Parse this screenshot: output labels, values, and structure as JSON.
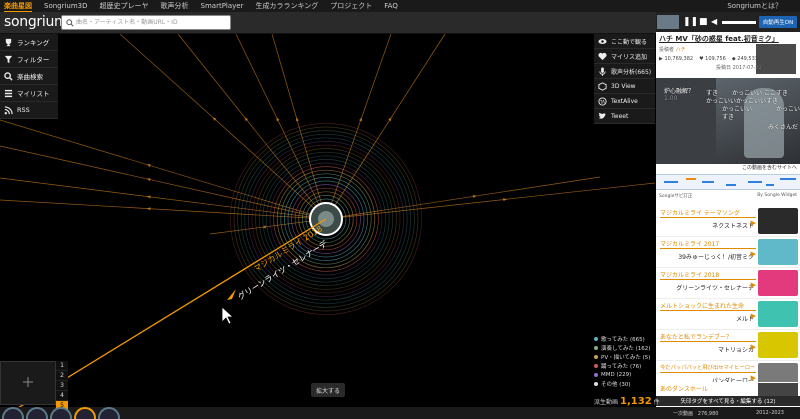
{
  "topnav": {
    "items": [
      "楽曲星図",
      "Songrium3D",
      "超歴史プレーヤ",
      "歌声分析",
      "SmartPlayer",
      "生成カラランキング",
      "プロジェクト",
      "FAQ"
    ],
    "right": "Songriumとは？"
  },
  "header": {
    "logo": "songrium",
    "search_placeholder": "曲名・アーティスト名・動画URL・ID"
  },
  "leftmenu": [
    {
      "label": "ランキング",
      "icon": "trophy-icon"
    },
    {
      "label": "フィルター",
      "icon": "filter-icon"
    },
    {
      "label": "楽曲検索",
      "icon": "search-icon"
    },
    {
      "label": "マイリスト",
      "icon": "list-icon"
    },
    {
      "label": "RSS",
      "icon": "rss-icon"
    }
  ],
  "rightmenu": [
    {
      "label": "ここ動で観る",
      "icon": "eye-icon"
    },
    {
      "label": "マイリス追加",
      "icon": "heart-icon"
    },
    {
      "label": "歌声分析(665)",
      "icon": "mic-icon"
    },
    {
      "label": "3D View",
      "icon": "3d-icon"
    },
    {
      "label": "TextAlive",
      "icon": "textalive-icon"
    },
    {
      "label": "Tweet",
      "icon": "twitter-icon"
    }
  ],
  "song": {
    "title": "ハチ MV「砂の惑星 feat.初音ミク」",
    "poster_label": "投稿者",
    "poster": "ハチ",
    "views": "10,769,382",
    "mylists": "109,756",
    "likes": "249,533",
    "date_label": "投稿日",
    "date": "2017-07-21"
  },
  "player": {
    "autoplay": "自動再生ON"
  },
  "video_comments": [
    "炉心融解？",
    "1.00",
    "すき",
    "かっこいい",
    "ここすき",
    "かっこいい",
    "かっこいい",
    "すき",
    "かっこいい",
    "かっこいい",
    "すき",
    "みくさんだ"
  ],
  "related_head": "この動画を含むサイトへ",
  "sabi": {
    "left": "Songleサビ訂正",
    "right": "By Songle Widget"
  },
  "related": [
    {
      "category": "マジカルミライ テーマソング",
      "song": "ネクストネスト",
      "thumb": "#2a2a2a"
    },
    {
      "category": "マジカルミライ 2017",
      "song": "39みゅーじっく！/初音ミク",
      "thumb": "#5fb9c8"
    },
    {
      "category": "マジカルミライ 2018",
      "song": "グリーンライツ・セレナーデ",
      "thumb": "#e23a7d"
    },
    {
      "category": "メルトショックに生まれた生命",
      "song": "メルト",
      "thumb": "#3fc2b0"
    },
    {
      "category": "あなたと私でランデブー？",
      "song": "マトリョシカ",
      "thumb": "#d8c600"
    },
    {
      "category": "今だパッパパッと飛び出せマイヒーロー",
      "song": "パンダヒーロー",
      "thumb": "#7a7a7a"
    },
    {
      "category": "あのダンスホール",
      "song": "",
      "thumb": "#444444"
    }
  ],
  "tagbar": "矢印タグをすべて見る・編集する (12)",
  "legend": [
    {
      "label": "歌ってみた (665)",
      "color": "#5ab4c8"
    },
    {
      "label": "演奏してみた (162)",
      "color": "#7fb27f"
    },
    {
      "label": "PV・描いてみた (5)",
      "color": "#c8a050"
    },
    {
      "label": "踊ってみた (76)",
      "color": "#d05a5a"
    },
    {
      "label": "MMD (229)",
      "color": "#9a6ac8"
    },
    {
      "label": "その他 (30)",
      "color": "#dddddd"
    }
  ],
  "totals": {
    "label": "派生動画",
    "count": "1,132",
    "unit": "件",
    "b1_label": "一次動画",
    "b1_value": "276,980",
    "b2": "2012–2023"
  },
  "canvas": {
    "zoom_button": "拡大する",
    "arrow_label_1": "マジカルミライ 2018",
    "arrow_label_2": "グリーンライツ・セレナーデ",
    "pages": [
      "1",
      "2",
      "3",
      "4",
      "5"
    ],
    "page_active": "5",
    "accent": "#f39800"
  }
}
